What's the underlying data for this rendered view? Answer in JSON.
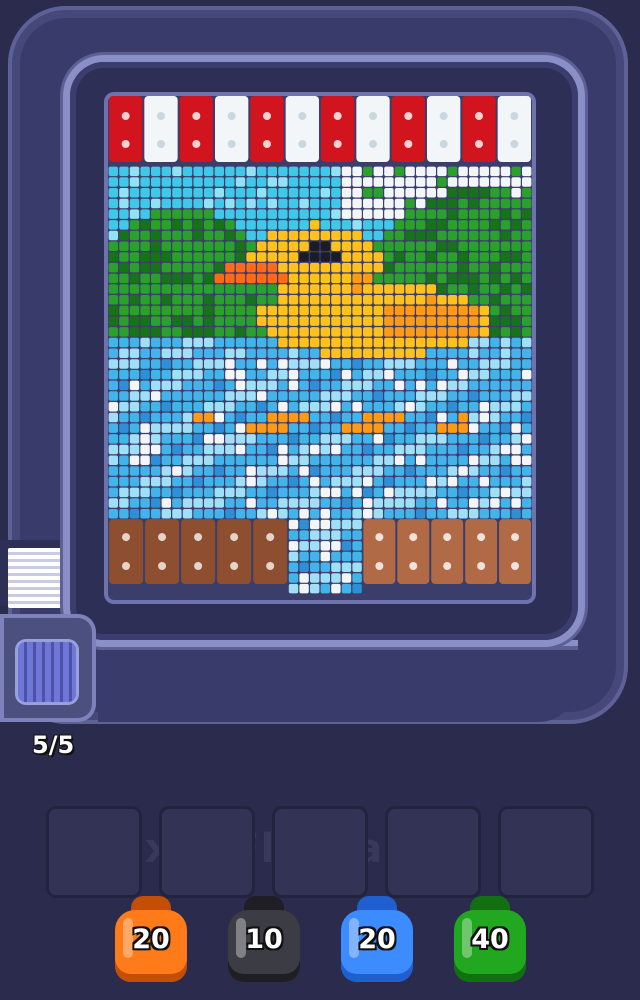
{
  "watermark": "Pixel-Flow.app",
  "progress": {
    "label": "5/5",
    "current": 5,
    "total": 5
  },
  "slots": {
    "count": 5,
    "filled": 0
  },
  "shooters": [
    {
      "count": "20",
      "color": "orange",
      "fill": "#ff7a18",
      "dark": "#c44e06"
    },
    {
      "count": "10",
      "color": "black",
      "fill": "#3c3c44",
      "dark": "#1e1e24"
    },
    {
      "count": "20",
      "color": "blue",
      "fill": "#3d8cff",
      "dark": "#1f5fd0"
    },
    {
      "count": "40",
      "color": "green",
      "fill": "#22a820",
      "dark": "#127012"
    }
  ],
  "palette": {
    "sky": "#3fc8e8",
    "sky_light": "#8fe3f4",
    "white": "#f2f6f8",
    "grass": "#2aa12a",
    "grass_dark": "#17731a",
    "duck": "#ffc21a",
    "duck_shade": "#ff9a14",
    "beak": "#ff6a18",
    "eye": "#1c1c24",
    "water": "#43b4ea",
    "water_light": "#9fe0f6",
    "water_deep": "#2e8fd6",
    "red_block": "#d1141e",
    "brown_block": "#8e4f30",
    "brown_light": "#b06a46"
  }
}
